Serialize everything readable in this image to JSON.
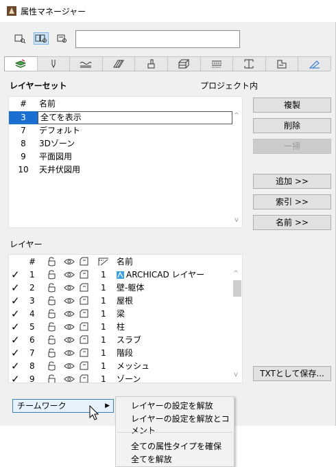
{
  "window": {
    "title": "属性マネージャー"
  },
  "toolbar": {
    "view_buttons": [
      {
        "icon": "list-view-icon"
      },
      {
        "icon": "split-view-icon"
      },
      {
        "icon": "detail-view-icon"
      }
    ],
    "search": {
      "value": "",
      "placeholder": ""
    }
  },
  "tabs": [
    {
      "icon": "layers-icon",
      "active": true
    },
    {
      "icon": "pen-icon"
    },
    {
      "icon": "line-type-icon"
    },
    {
      "icon": "fill-icon"
    },
    {
      "icon": "surface-icon"
    },
    {
      "icon": "building-material-icon"
    },
    {
      "icon": "composite-icon"
    },
    {
      "icon": "profile-icon"
    },
    {
      "icon": "zone-category-icon"
    },
    {
      "icon": "marker-icon"
    }
  ],
  "layer_sets": {
    "heading": "レイヤーセット",
    "scope": "プロジェクト内",
    "col_num": "#",
    "col_name": "名前",
    "rows": [
      {
        "num": "3",
        "name": "全てを表示",
        "selected": true
      },
      {
        "num": "7",
        "name": "デフォルト"
      },
      {
        "num": "8",
        "name": "3Dゾーン"
      },
      {
        "num": "9",
        "name": "平面図用"
      },
      {
        "num": "10",
        "name": "天井伏図用"
      }
    ]
  },
  "buttons": {
    "duplicate": "複製",
    "delete": "削除",
    "purge": "一掃",
    "add": "追加 >>",
    "index": "索引 >>",
    "name": "名前 >>",
    "export_txt": "TXTとして保存..."
  },
  "layers": {
    "heading": "レイヤー",
    "col_num": "#",
    "col_name": "名前",
    "rows": [
      {
        "num": "1",
        "pen": "1",
        "name": "ARCHICAD レイヤー",
        "special": true
      },
      {
        "num": "2",
        "pen": "1",
        "name": "壁-躯体"
      },
      {
        "num": "3",
        "pen": "1",
        "name": "屋根"
      },
      {
        "num": "4",
        "pen": "1",
        "name": "梁"
      },
      {
        "num": "5",
        "pen": "1",
        "name": "柱"
      },
      {
        "num": "6",
        "pen": "1",
        "name": "スラブ"
      },
      {
        "num": "7",
        "pen": "1",
        "name": "階段"
      },
      {
        "num": "8",
        "pen": "1",
        "name": "メッシュ"
      },
      {
        "num": "9",
        "pen": "1",
        "name": "ゾーン"
      }
    ],
    "check_symbol": "✓"
  },
  "teamwork": {
    "label": "チームワーク",
    "arrow": "▶",
    "menu": [
      "レイヤーの設定を解放",
      "レイヤーの設定を解放とコメント",
      "全ての属性タイプを確保",
      "全てを解放"
    ]
  },
  "scroll": {
    "up": "^",
    "down": "v",
    "up_arrow": "▲",
    "down_arrow": "▼"
  },
  "colors": {
    "selection": "#1a6fd1",
    "menu_hover": "#e5f1fb",
    "accent_border": "#3c7fb1"
  }
}
